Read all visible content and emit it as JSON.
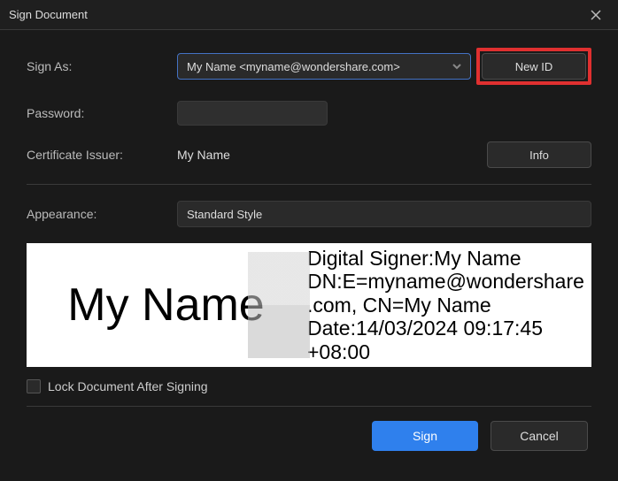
{
  "window": {
    "title": "Sign Document"
  },
  "labels": {
    "sign_as": "Sign As:",
    "password": "Password:",
    "certificate_issuer": "Certificate Issuer:",
    "appearance": "Appearance:",
    "lock_after_signing": "Lock Document After Signing"
  },
  "fields": {
    "sign_as_value": "My Name <myname@wondershare.com>",
    "password_value": "",
    "certificate_issuer_value": "My Name",
    "appearance_value": "Standard Style"
  },
  "buttons": {
    "new_id": "New ID",
    "info": "Info",
    "sign": "Sign",
    "cancel": "Cancel"
  },
  "preview": {
    "display_name": "My Name",
    "line1": "Digital Signer:My Name",
    "line2": "DN:E=myname@wondershare.com, CN=My Name",
    "line3": "Date:14/03/2024 09:17:45 +08:00"
  },
  "highlight": {
    "target": "new-id-button",
    "color": "#e03030"
  }
}
